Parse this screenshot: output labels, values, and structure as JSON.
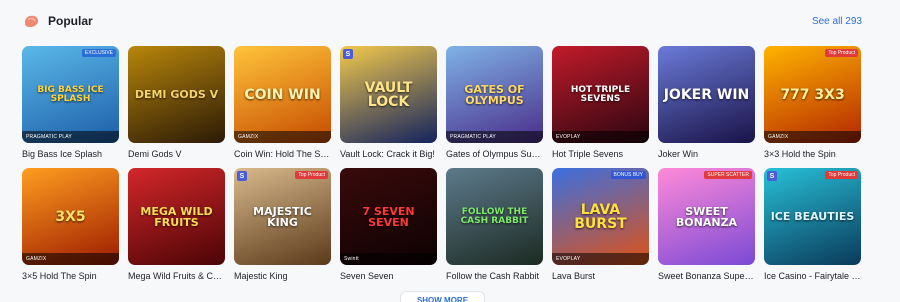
{
  "section": {
    "title": "Popular",
    "see_all": "See all 293",
    "icon": "popular-icon",
    "accent": "#2a6fd9"
  },
  "games": [
    {
      "title": "Big Bass Ice Splash",
      "art": "BIG BASS ICE SPLASH",
      "provider": "PRAGMATIC PLAY",
      "badge": "EXCLUSIVE",
      "bg": "linear-gradient(160deg,#5ab8e8,#1d5ea8)",
      "text_color": "#ffd43b",
      "s": false
    },
    {
      "title": "Demi Gods V",
      "art": "Demi Gods V",
      "provider": "",
      "badge": "",
      "bg": "linear-gradient(160deg,#b8860b,#2b1a06)",
      "text_color": "#f5d36b",
      "s": false
    },
    {
      "title": "Coin Win: Hold The Spin",
      "art": "COIN WIN",
      "provider": "GAMZIX",
      "badge": "",
      "bg": "linear-gradient(160deg,#ffc43a,#c64b00)",
      "text_color": "#fff3b0",
      "s": false
    },
    {
      "title": "Vault Lock: Crack it Big!",
      "art": "VAULT LOCK",
      "provider": "",
      "badge": "",
      "bg": "linear-gradient(160deg,#f2c94c,#12225e)",
      "text_color": "#ffe58a",
      "s": true
    },
    {
      "title": "Gates of Olympus Super Scatter",
      "art": "GATES OF OLYMPUS",
      "provider": "PRAGMATIC PLAY",
      "badge": "",
      "bg": "linear-gradient(160deg,#7fb2e6,#4a2d8a)",
      "text_color": "#ffd966",
      "s": false
    },
    {
      "title": "Hot Triple Sevens",
      "art": "Hot Triple SEVENS",
      "provider": "EVOPLAY",
      "badge": "",
      "bg": "linear-gradient(160deg,#c21b2a,#2a0611)",
      "text_color": "#ffffff",
      "s": false
    },
    {
      "title": "Joker Win",
      "art": "JOKER WIN",
      "provider": "",
      "badge": "",
      "bg": "linear-gradient(160deg,#6a7bd8,#1a1348)",
      "text_color": "#ffffff",
      "s": false
    },
    {
      "title": "3×3 Hold the Spin",
      "art": "777 3X3",
      "provider": "GAMZIX",
      "badge": "Top Product",
      "bg": "linear-gradient(160deg,#ffb300,#b32600)",
      "text_color": "#fff0a0",
      "s": false
    },
    {
      "title": "3×5 Hold The Spin",
      "art": "3X5",
      "provider": "GAMZIX",
      "badge": "",
      "bg": "linear-gradient(160deg,#ff9d1f,#9c1b00)",
      "text_color": "#ffe066",
      "s": false
    },
    {
      "title": "Mega Wild Fruits & Chilli",
      "art": "MEGA WILD FRUITS",
      "provider": "",
      "badge": "",
      "bg": "linear-gradient(160deg,#d4272a,#4b0406)",
      "text_color": "#ffdd55",
      "s": false
    },
    {
      "title": "Majestic King",
      "art": "MAJESTIC KING",
      "provider": "",
      "badge": "Top Product",
      "bg": "linear-gradient(160deg,#d9b98c,#5a3a1a)",
      "text_color": "#ffffff",
      "s": true
    },
    {
      "title": "Seven Seven",
      "art": "7 SEVEN SEVEN",
      "provider": "Swintt",
      "badge": "",
      "bg": "linear-gradient(160deg,#3a0a0a,#0d0204)",
      "text_color": "#ff3838",
      "s": false
    },
    {
      "title": "Follow the Cash Rabbit",
      "art": "FOLLOW THE CASH RABBIT",
      "provider": "",
      "badge": "",
      "bg": "linear-gradient(160deg,#5d7a8c,#1c2a22)",
      "text_color": "#7ee86b",
      "s": false
    },
    {
      "title": "Lava Burst",
      "art": "LAVA BURST",
      "provider": "EVOPLAY",
      "badge": "BONUS BUY",
      "bg": "linear-gradient(160deg,#3b6fe0,#e05214)",
      "text_color": "#ffe040",
      "s": false
    },
    {
      "title": "Sweet Bonanza Super Scatter",
      "art": "SWEET BONANZA",
      "provider": "",
      "badge": "SUPER SCATTER",
      "bg": "linear-gradient(160deg,#ff8ad8,#7a4ad6)",
      "text_color": "#ffffff",
      "s": false
    },
    {
      "title": "Ice Casino - Fairytale Beauties",
      "art": "ICE BEAUTIES",
      "provider": "",
      "badge": "Top Product",
      "bg": "linear-gradient(160deg,#28c0d8,#0a3a5a)",
      "text_color": "#dff8ff",
      "s": true
    }
  ],
  "show_more": "SHOW MORE"
}
